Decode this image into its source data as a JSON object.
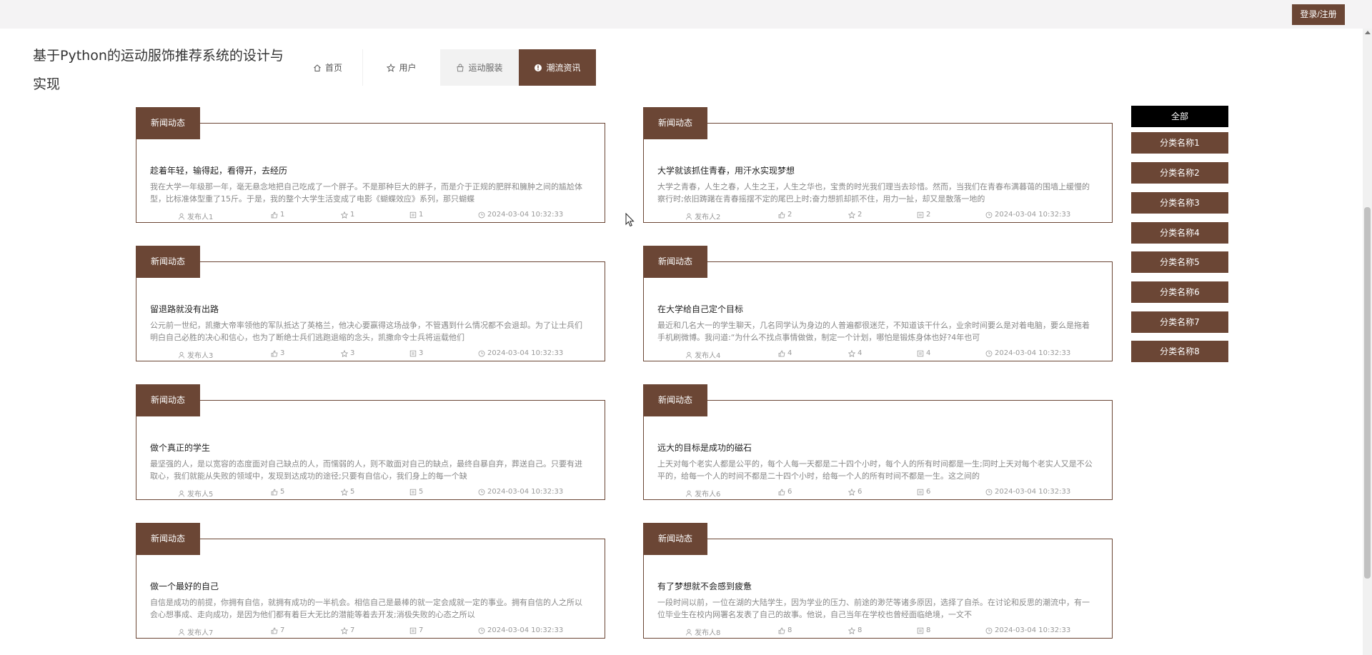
{
  "header": {
    "login_label": "登录/注册",
    "site_title": "基于Python的运动服饰推荐系统的设计与实现"
  },
  "nav": [
    {
      "label": "首页",
      "icon": "home-icon"
    },
    {
      "label": "用户",
      "icon": "star-icon"
    },
    {
      "label": "运动服装",
      "icon": "bag-icon"
    },
    {
      "label": "潮流资讯",
      "icon": "info-icon",
      "active": true
    }
  ],
  "news": [
    {
      "tag": "新闻动态",
      "title": "趁着年轻，输得起，看得开，去经历",
      "desc": "我在大学一年级那一年，毫无悬念地把自己吃成了一个胖子。不是那种巨大的胖子，而是介于正规的肥胖和臃肿之间的尴尬体型，比标准体型重了15斤。于是，我的整个大学生活变成了电影《蝴蝶效应》系列，那只蝴蝶",
      "author": "发布人1",
      "likes": "1",
      "favs": "1",
      "comments": "1",
      "time": "2024-03-04 10:32:33"
    },
    {
      "tag": "新闻动态",
      "title": "大学就该抓住青春，用汗水实现梦想",
      "desc": "大学之青春，人生之春，人生之王，人生之华也，宝贵的时光我们理当去珍惜。然而，当我们在青春布满暮蔼的围墙上缓慢的察行时;依旧踌躇在青春摇摆不定的尾巴上时;奋力想抓却抓不住，用力一扯，却又是散落一地的",
      "author": "发布人2",
      "likes": "2",
      "favs": "2",
      "comments": "2",
      "time": "2024-03-04 10:32:33"
    },
    {
      "tag": "新闻动态",
      "title": "留退路就没有出路",
      "desc": "公元前一世纪，凯撒大帝率领他的军队抵达了英格兰，他决心要赢得这场战争，不管遇到什么情况都不会退却。为了让士兵们明白自己必胜的决心和信心，也为了断绝士兵们逃跑退缩的念头，凯撒命令士兵将运载他们",
      "author": "发布人3",
      "likes": "3",
      "favs": "3",
      "comments": "3",
      "time": "2024-03-04 10:32:33"
    },
    {
      "tag": "新闻动态",
      "title": "在大学给自己定个目标",
      "desc": "最近和几名大一的学生聊天，几名同学认为身边的人普遍都很迷茫，不知道该干什么，业余时间要么是对着电脑，要么是拖着手机刷微博。我问道:“为什么不找点事情做做，制定一个计划，哪怕是锻炼身体也好?4年也可",
      "author": "发布人4",
      "likes": "4",
      "favs": "4",
      "comments": "4",
      "time": "2024-03-04 10:32:33"
    },
    {
      "tag": "新闻动态",
      "title": "做个真正的学生",
      "desc": "最坚强的人，是以宽容的态度面对自己缺点的人，而懦弱的人，则不敢面对自己的缺点，最终自暴自弃，葬送自己。只要有进取心，我们就能从失败的领域中，发现到达成功的途径;只要有自信心，我们身上的每一个缺",
      "author": "发布人5",
      "likes": "5",
      "favs": "5",
      "comments": "5",
      "time": "2024-03-04 10:32:33"
    },
    {
      "tag": "新闻动态",
      "title": "远大的目标是成功的磁石",
      "desc": "上天对每个老实人都是公平的，每个人每一天都是二十四个小时，每个人的所有时间都是一生;同时上天对每个老实人又是不公平的，给每一个人的时间不都是二十四个小时，给每一个人的所有时间不都是一生。这之间的",
      "author": "发布人6",
      "likes": "6",
      "favs": "6",
      "comments": "6",
      "time": "2024-03-04 10:32:33"
    },
    {
      "tag": "新闻动态",
      "title": "做一个最好的自己",
      "desc": "自信是成功的前提，你拥有自信，就拥有成功的一半机会。相信自己是最棒的就一定会成就一定的事业。拥有自信的人之所以会心想事成、走向成功，是因为他们都有着巨大无比的潜能等着去开发;消极失败的心态之所以",
      "author": "发布人7",
      "likes": "7",
      "favs": "7",
      "comments": "7",
      "time": "2024-03-04 10:32:33"
    },
    {
      "tag": "新闻动态",
      "title": "有了梦想就不会感到疲惫",
      "desc": "一段时间以前，一位在湖的大陆学生，因为学业的压力、前途的渺茫等诸多原因，选择了自杀。在讨论和反思的潮流中，有一位毕业生在校内网署名发表了自己的故事。他说，自己当年在学校也曾经面临绝境，一文不",
      "author": "发布人8",
      "likes": "8",
      "favs": "8",
      "comments": "8",
      "time": "2024-03-04 10:32:33"
    }
  ],
  "categories": [
    "全部",
    "分类名称1",
    "分类名称2",
    "分类名称3",
    "分类名称4",
    "分类名称5",
    "分类名称6",
    "分类名称7",
    "分类名称8"
  ],
  "colors": {
    "accent": "#6b4635",
    "active_category": "#000000"
  }
}
